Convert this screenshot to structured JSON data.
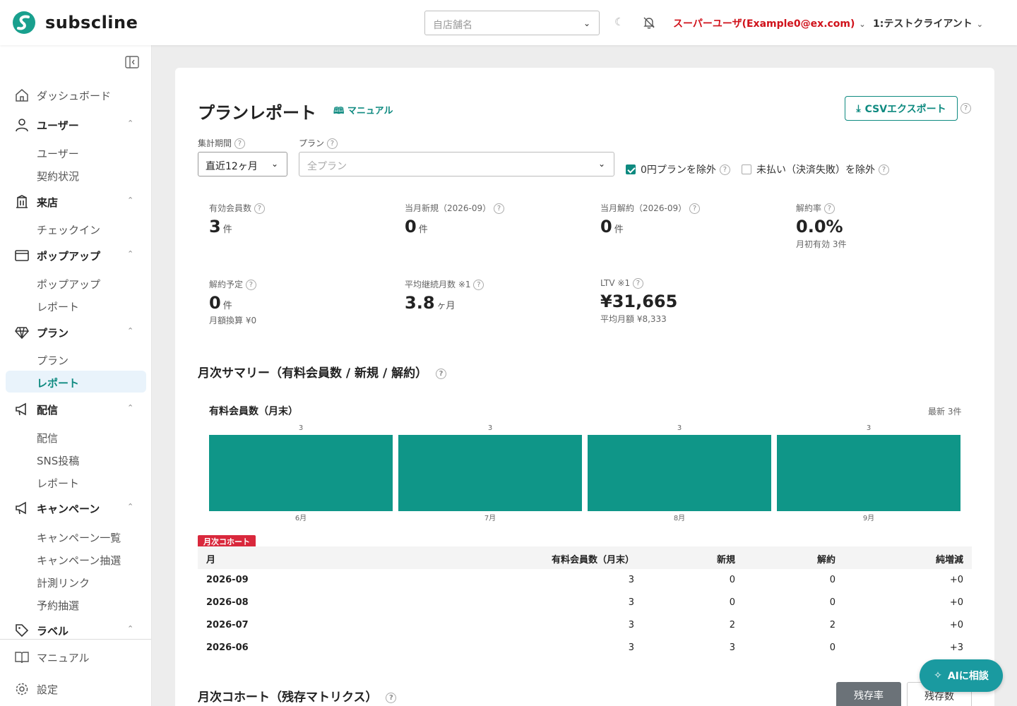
{
  "header": {
    "logo_text": "subscline",
    "store_placeholder": "自店舗名",
    "user_label": "スーパーユーザ(Example0@ex.com)",
    "client_label": "1:テストクライアント"
  },
  "sidebar": {
    "dashboard": "ダッシュボード",
    "groups": [
      {
        "label": "ユーザー",
        "items": [
          "ユーザー",
          "契約状況"
        ]
      },
      {
        "label": "来店",
        "items": [
          "チェックイン"
        ]
      },
      {
        "label": "ポップアップ",
        "items": [
          "ポップアップ",
          "レポート"
        ]
      },
      {
        "label": "プラン",
        "items": [
          "プラン",
          "レポート"
        ]
      },
      {
        "label": "配信",
        "items": [
          "配信",
          "SNS投稿",
          "レポート"
        ]
      },
      {
        "label": "キャンペーン",
        "items": [
          "キャンペーン一覧",
          "キャンペーン抽選",
          "計測リンク",
          "予約抽選"
        ]
      },
      {
        "label": "ラベル",
        "items": []
      }
    ],
    "manual": "マニュアル",
    "settings": "設定"
  },
  "page": {
    "title": "プランレポート",
    "manual_link": "マニュアル",
    "csv_button": "CSVエクスポート",
    "period_label": "集計期間",
    "period_value": "直近12ヶ月",
    "plan_label": "プラン",
    "plan_placeholder": "全プラン",
    "exclude_zero": "0円プランを除外",
    "exclude_zero_checked": true,
    "exclude_unpaid": "未払い（決済失敗）を除外",
    "exclude_unpaid_checked": false
  },
  "kpis": [
    {
      "label": "有効会員数",
      "value": "3",
      "unit": "件",
      "sub": ""
    },
    {
      "label": "当月新規（2026-09）",
      "value": "0",
      "unit": "件",
      "sub": ""
    },
    {
      "label": "当月解約（2026-09）",
      "value": "0",
      "unit": "件",
      "sub": ""
    },
    {
      "label": "解約率",
      "value": "0.0%",
      "unit": "",
      "sub": "月初有効 3件"
    },
    {
      "label": "解約予定",
      "value": "0",
      "unit": "件",
      "sub": "月額換算 ¥0"
    },
    {
      "label": "平均継続月数 ※1",
      "value": "3.8",
      "unit": "ヶ月",
      "sub": ""
    },
    {
      "label": "LTV ※1",
      "value": "¥31,665",
      "unit": "",
      "sub": "平均月額 ¥8,333"
    }
  ],
  "summary": {
    "title": "月次サマリー（有料会員数 / 新規 / 解約）",
    "chart_title": "有料会員数（月末）",
    "chart_note": "最新 3件"
  },
  "chart_data": {
    "type": "bar",
    "categories": [
      "6月",
      "7月",
      "8月",
      "9月"
    ],
    "values": [
      3,
      3,
      3,
      3
    ],
    "title": "有料会員数（月末）",
    "color": "#0f9688"
  },
  "cohort": {
    "badge": "月次コホート",
    "headers": [
      "月",
      "有料会員数（月末）",
      "新規",
      "解約",
      "純増減"
    ],
    "rows": [
      [
        "2026-09",
        "3",
        "0",
        "0",
        "+0"
      ],
      [
        "2026-08",
        "3",
        "0",
        "0",
        "+0"
      ],
      [
        "2026-07",
        "3",
        "2",
        "2",
        "+0"
      ],
      [
        "2026-06",
        "3",
        "3",
        "0",
        "+3"
      ]
    ]
  },
  "matrix": {
    "title": "月次コホート（残存マトリクス）",
    "tab_rate": "残存率",
    "tab_count": "残存数"
  },
  "ai_button": "AIに相談",
  "colors": {
    "accent": "#0e8a80",
    "user": "#d0121b",
    "bar": "#0f9688",
    "badge": "#d9283c"
  }
}
